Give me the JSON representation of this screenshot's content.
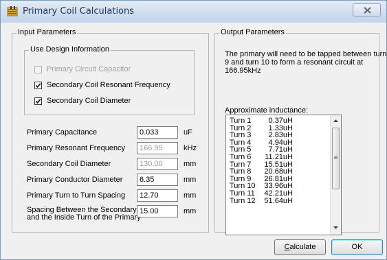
{
  "window": {
    "title": "Primary Coil Calculations"
  },
  "input_group": {
    "label": "Input Parameters",
    "design_group": {
      "label": "Use Design Information",
      "checkboxes": [
        {
          "label": "Primary Circuit Capacitor",
          "checked": false,
          "enabled": false
        },
        {
          "label": "Secondary Coil  Resonant Frequency",
          "checked": true,
          "enabled": true
        },
        {
          "label": "Secondary Coil Diameter",
          "checked": true,
          "enabled": true
        }
      ]
    },
    "fields": [
      {
        "label": "Primary Capacitance",
        "value": "0.033",
        "unit": "uF",
        "enabled": true
      },
      {
        "label": "Primary Resonant Frequency",
        "value": "166.95",
        "unit": "kHz",
        "enabled": false
      },
      {
        "label": "Secondary Coil Diameter",
        "value": "130.00",
        "unit": "mm",
        "enabled": false
      },
      {
        "label": "Primary Conductor Diameter",
        "value": "6.35",
        "unit": "mm",
        "enabled": true
      },
      {
        "label": "Primary Turn to Turn Spacing",
        "value": "12.70",
        "unit": "mm",
        "enabled": true
      },
      {
        "label": "Spacing Between the Secondary",
        "label2": "and the Inside Turn of the Primary",
        "value": "15.00",
        "unit": "mm",
        "enabled": true
      }
    ]
  },
  "output_group": {
    "label": "Output Parameters",
    "message_lines": [
      "The primary will need to be tapped between turn",
      "9 and turn 10 to form a resonant circuit at",
      "166.95kHz"
    ],
    "inductance_label": "Approximate inductance:",
    "turns": [
      {
        "turn": "Turn  1",
        "value": "0.37uH"
      },
      {
        "turn": "Turn  2",
        "value": "1.33uH"
      },
      {
        "turn": "Turn  3",
        "value": "2.83uH"
      },
      {
        "turn": "Turn  4",
        "value": "4.94uH"
      },
      {
        "turn": "Turn  5",
        "value": "7.71uH"
      },
      {
        "turn": "Turn  6",
        "value": "11.21uH"
      },
      {
        "turn": "Turn  7",
        "value": "15.51uH"
      },
      {
        "turn": "Turn  8",
        "value": "20.68uH"
      },
      {
        "turn": "Turn  9",
        "value": "26.81uH"
      },
      {
        "turn": "Turn  10",
        "value": "33.96uH"
      },
      {
        "turn": "Turn  11",
        "value": "42.21uH"
      },
      {
        "turn": "Turn  12",
        "value": "51.64uH"
      }
    ]
  },
  "buttons": {
    "calculate": "Calculate",
    "ok": "OK"
  },
  "colors": {
    "title_text": "#1e3957",
    "disabled_text": "#a0a0a0",
    "accent_border": "#3c7fb1"
  }
}
